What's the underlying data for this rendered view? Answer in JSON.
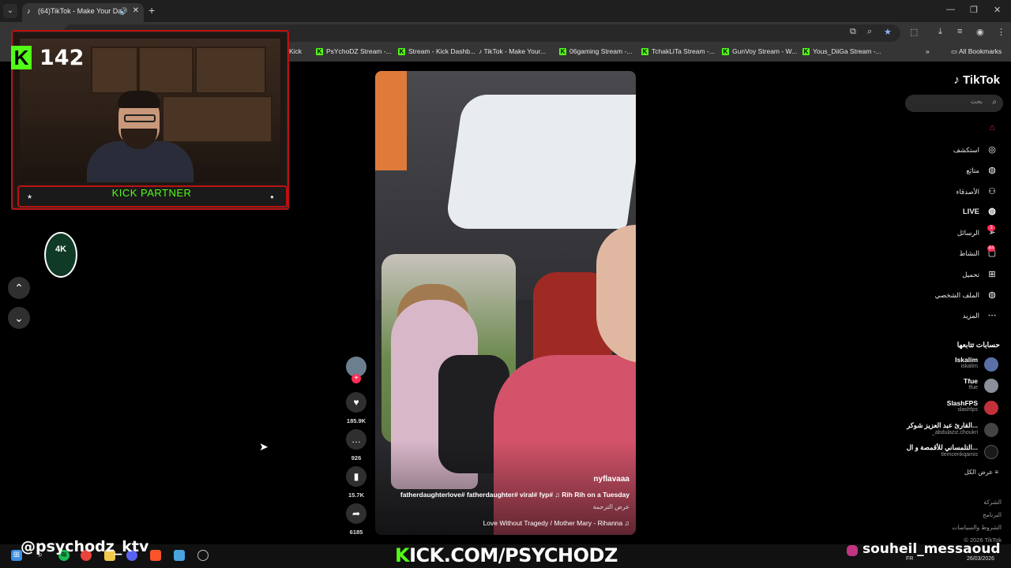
{
  "browser": {
    "tab_title": "(64)TikTok - Make Your Day",
    "bookmarks": [
      "Kick",
      "PsYchoDZ Stream -...",
      "Stream - Kick Dashb...",
      "TikTok - Make Your...",
      "06gaming Stream -...",
      "TchakLiTa Stream -...",
      "GunVoy Stream - W...",
      "Yous_DiiGa Stream -..."
    ],
    "all_bookmarks": "All Bookmarks"
  },
  "stream_overlay": {
    "viewer_count": "142",
    "partner_label": "KICK PARTNER",
    "badge_text": "4K",
    "handle_left": "@psychodz_ktv",
    "kick_url_prefix": "K",
    "kick_url_rest": "ICK.COM/PSYCHODZ",
    "handle_right": "souheil_messaoud"
  },
  "tiktok": {
    "logo": "TikTok",
    "search_placeholder": "بحث",
    "nav": [
      {
        "label": "",
        "icon": "home-icon",
        "active": true
      },
      {
        "label": "استكشف",
        "icon": "compass-icon"
      },
      {
        "label": "متابَع",
        "icon": "following-avatar-icon"
      },
      {
        "label": "الأصدقاء",
        "icon": "friends-icon"
      },
      {
        "label": "LIVE",
        "icon": "live-avatar-icon"
      },
      {
        "label": "الرسائل",
        "icon": "send-icon",
        "badge": "3"
      },
      {
        "label": "النشاط",
        "icon": "activity-icon",
        "badge": "64"
      },
      {
        "label": "تحميل",
        "icon": "upload-icon"
      },
      {
        "label": "الملف الشخصي",
        "icon": "profile-avatar-icon"
      },
      {
        "label": "المزيد",
        "icon": "more-icon"
      }
    ],
    "following_heading": "حسابات تتابعها",
    "accounts": [
      {
        "name": "Iskalim",
        "handle": "iskalim"
      },
      {
        "name": "Tfue",
        "handle": "tfue"
      },
      {
        "name": "SlashFPS",
        "handle": "slashfps"
      },
      {
        "name": "القارئ عبد العزيز شوكر...",
        "handle": "_abdulaziz.choukri"
      },
      {
        "name": "التلمساني للأقمصة و ال...",
        "handle": "tlemcenkqamis"
      }
    ],
    "see_all": "عرض الكل",
    "footer": [
      "الشركة",
      "البرنامج",
      "الشروط والسياسات",
      "© 2026 TikTok"
    ]
  },
  "video": {
    "author": "nyflavaaa",
    "caption": "fatherdaughterlove# fatherdaughter# viral# fyp# ♫ Rih Rih on a Tuesday",
    "translate": "عرض الترجمة",
    "music": "Love Without Tragedy / Mother Mary - Rihanna ♫",
    "likes": "185.9K",
    "comments": "926",
    "saves": "15.7K",
    "shares": "6185"
  },
  "taskbar": {
    "lang": "FR",
    "date": "26/03/2026"
  },
  "colors": {
    "kick_green": "#53fc18",
    "tiktok_red": "#fe2c55",
    "frame_red": "#bb1111"
  }
}
